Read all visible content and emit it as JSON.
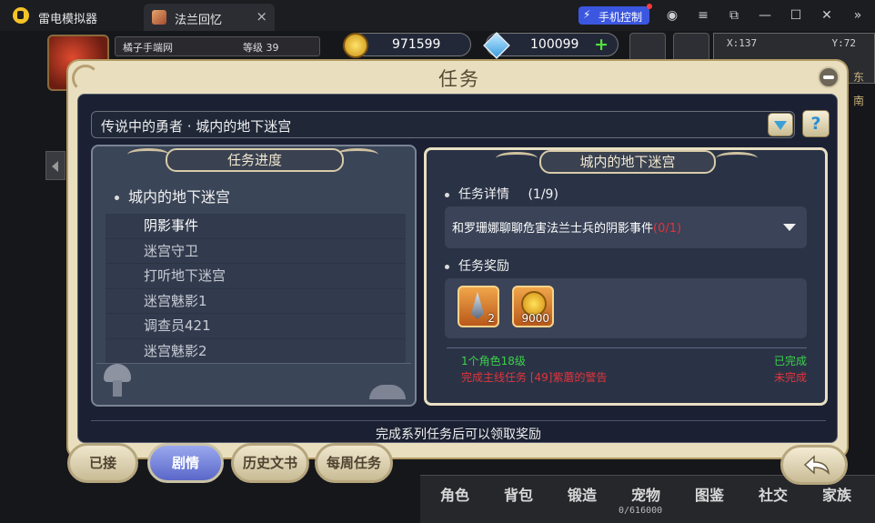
{
  "window": {
    "app_name": "雷电模拟器",
    "tab_label": "法兰回忆",
    "tab_close": "×",
    "phone_control": "手机控制",
    "buttons": [
      "user-icon",
      "menu-icon",
      "popout-icon",
      "minimize-icon",
      "maximize-icon",
      "close-icon",
      "collapse-icon"
    ]
  },
  "hud": {
    "player_name": "橘子手端网",
    "level_label": "等级 39",
    "gold": "971599",
    "diamonds": "100099",
    "coord_x": "X:137",
    "coord_y": "Y:72",
    "map_dir_1": "东",
    "map_dir_2": "南",
    "menu": [
      {
        "label": "角色"
      },
      {
        "label": "背包"
      },
      {
        "label": "锻造"
      },
      {
        "label": "宠物"
      },
      {
        "label": "图鉴"
      },
      {
        "label": "社交"
      },
      {
        "label": "家族"
      }
    ],
    "exp": "0/616000"
  },
  "dialog": {
    "title": "任务",
    "chapter": "传说中的勇者 · 城内的地下迷宫",
    "progress_banner": "任务进度",
    "detail_banner": "城内的地下迷宫",
    "section_title": "城内的地下迷宫",
    "quests": [
      {
        "label": "阴影事件",
        "active": true
      },
      {
        "label": "迷宫守卫",
        "active": false
      },
      {
        "label": "打听地下迷宫",
        "active": false
      },
      {
        "label": "迷宫魅影1",
        "active": false
      },
      {
        "label": "调查员421",
        "active": false
      },
      {
        "label": "迷宫魅影2",
        "active": false
      }
    ],
    "detail_label": "任务详情",
    "detail_count": "(1/9)",
    "detail_text": "和罗珊娜聊聊危害法兰士兵的阴影事件",
    "detail_progress": "(0/1)",
    "reward_label": "任务奖励",
    "rewards": [
      {
        "icon": "blade-icon",
        "qty": "2"
      },
      {
        "icon": "gold-coin-icon",
        "qty": "9000"
      }
    ],
    "conditions": [
      {
        "text": "1个角色18级",
        "status": "已完成",
        "color": "#3bd14a"
      },
      {
        "text": "完成主线任务 [49]紫蘑的警告",
        "status": "未完成",
        "color": "#e2343c"
      }
    ],
    "hint": "完成系列任务后可以领取奖励",
    "tabs": [
      {
        "label": "已接",
        "active": false
      },
      {
        "label": "剧情",
        "active": true
      },
      {
        "label": "历史文书",
        "active": false
      },
      {
        "label": "每周任务",
        "active": false
      }
    ]
  }
}
